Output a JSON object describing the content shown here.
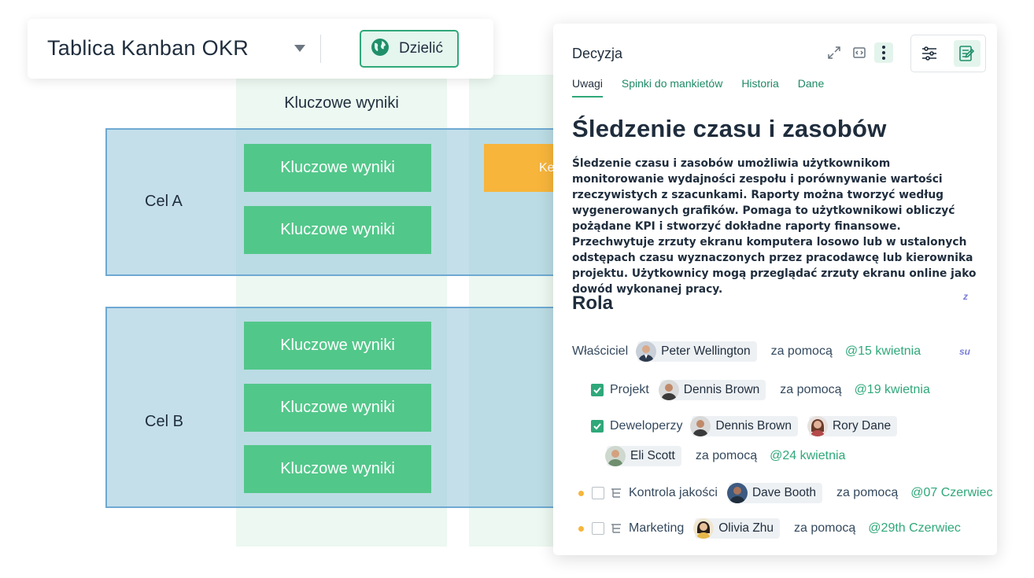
{
  "board": {
    "title": "Tablica Kanban OKR",
    "share_label": "Dzielić",
    "column_header": "Kluczowe wyniki",
    "goals": [
      {
        "label": "Cel A",
        "cards": [
          "Kluczowe wyniki",
          "Kluczowe wyniki"
        ]
      },
      {
        "label": "Cel B",
        "cards": [
          "Kluczowe wyniki",
          "Kluczowe wyniki",
          "Kluczowe wyniki"
        ]
      }
    ],
    "orange_card_label": "Ke"
  },
  "panel": {
    "title": "Decyzja",
    "tabs": [
      "Uwagi",
      "Spinki do mankietów",
      "Historia",
      "Dane"
    ],
    "active_tab": "Uwagi",
    "content_title": "Śledzenie czasu i zasobów",
    "description": "Śledzenie czasu i zasobów umożliwia użytkownikom monitorowanie wydajności zespołu i porównywanie wartości rzeczywistych z szacunkami. Raporty można tworzyć według wygenerowanych grafików. Pomaga to użytkownikowi obliczyć pożądane KPI i stworzyć dokładne raporty finansowe. Przechwytuje zrzuty ekranu komputera losowo lub w ustalonych odstępach czasu wyznaczonych przez pracodawcę lub kierownika projektu. Użytkownicy mogą przeglądać zrzuty ekranu online jako dowód wykonanej pracy.",
    "role_title": "Rola",
    "collab_letters": [
      "z",
      "su"
    ],
    "via_label": "za pomocą",
    "roles": [
      {
        "label": "Właściciel",
        "people": [
          "Peter Wellington"
        ],
        "date": "@15 kwietnia"
      },
      {
        "label": "Projekt",
        "people": [
          "Dennis Brown"
        ],
        "date": "@19 kwietnia",
        "checked": true
      },
      {
        "label": "Deweloperzy",
        "people": [
          "Dennis Brown",
          "Rory Dane",
          "Eli Scott"
        ],
        "date": "@24 kwietnia",
        "checked": true
      },
      {
        "label": "Kontrola jakości",
        "people": [
          "Dave Booth"
        ],
        "date": "@07 Czerwiec",
        "checked": false
      },
      {
        "label": "Marketing",
        "people": [
          "Olivia Zhu"
        ],
        "date": "@29th Czerwiec",
        "checked": false
      }
    ]
  },
  "colors": {
    "accent": "#2fa87a",
    "card_green": "#52c78a",
    "card_orange": "#f7b53b",
    "goal_row_fill": "#94c5d8",
    "goal_row_border": "#6ea9d2"
  }
}
